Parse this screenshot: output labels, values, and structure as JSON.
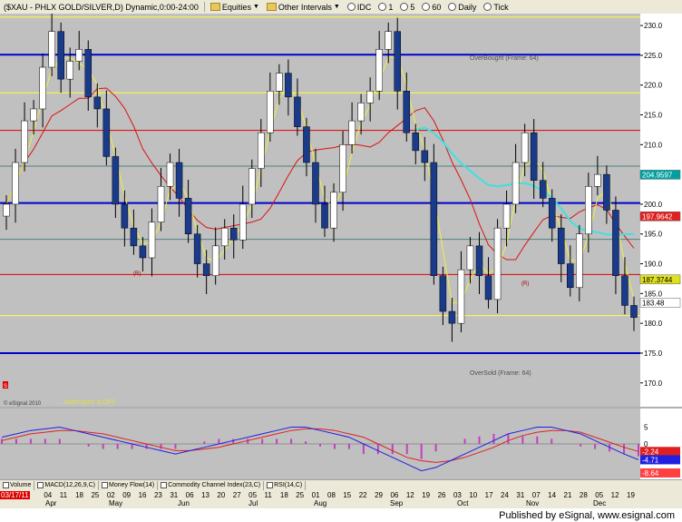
{
  "toolbar": {
    "symbol_title": "($XAU - PHLX GOLD/SILVER,D) Dynamic,0:00-24:00",
    "equities": "Equities",
    "other_intervals": "Other Intervals",
    "intervals": [
      "IDC",
      "1",
      "5",
      "60",
      "Daily",
      "Tick"
    ]
  },
  "annotations": {
    "overbought": "OverBought (Frame: 64)",
    "oversold": "OverSold (Frame: 64)",
    "autoframe": "AutoFrame is OFF",
    "copyright": "© eSignal 2010",
    "r_label": "(R)",
    "s_label": "S"
  },
  "price_tags": [
    {
      "text": "204.9597",
      "color": "#00a0a0"
    },
    {
      "text": "197.9642",
      "color": "#e02020"
    },
    {
      "text": "187.3744",
      "color": "#e0e020"
    },
    {
      "text": "183.48",
      "color": "#ffffff"
    }
  ],
  "macd_tags": [
    {
      "text": "-2.24",
      "color": "#e02020"
    },
    {
      "text": "-4.71",
      "color": "#2020e0"
    },
    {
      "text": "-8.64",
      "color": "#ff4040"
    }
  ],
  "date_start": "03/17/11",
  "x_day_labels": [
    "28",
    "04",
    "11",
    "18",
    "25",
    "02",
    "09",
    "16",
    "23",
    "31",
    "06",
    "13",
    "20",
    "27",
    "05",
    "11",
    "18",
    "25",
    "01",
    "08",
    "15",
    "22",
    "29",
    "06",
    "12",
    "19",
    "26",
    "03",
    "10",
    "17",
    "24",
    "31",
    "07",
    "14",
    "21",
    "28",
    "05",
    "12",
    "19"
  ],
  "x_month_labels": [
    "Apr",
    "May",
    "Jun",
    "Jul",
    "Aug",
    "Sep",
    "Oct",
    "Nov",
    "Dec"
  ],
  "indicator_tabs": [
    "Volume",
    "MACD(12,26,9,C)",
    "Money Flow(14)",
    "Commodity Channel Index(23,C)",
    "RSI(14,C)"
  ],
  "footer": "Published by eSignal, www.esignal.com",
  "colors": {
    "chart_bg": "#c0c0c0",
    "candle_up": "#ffffff",
    "candle_down": "#1a3a8a",
    "ma_red": "#e01010",
    "ma_yellow": "#f0f040",
    "ma_cyan": "#40e0e0",
    "level_blue": "#0000cc",
    "level_red": "#e00000",
    "level_yellow": "#ffff40",
    "level_teal": "#508080"
  },
  "chart_data": [
    {
      "type": "candlestick",
      "title": "($XAU - PHLX GOLD/SILVER,D) Dynamic,0:00-24:00",
      "ylim": [
        166,
        232
      ],
      "yticks": [
        170,
        175,
        180,
        185,
        190,
        195,
        200,
        205,
        210,
        215,
        220,
        225,
        230
      ],
      "close": [
        200,
        207,
        214,
        216,
        223,
        229,
        221,
        224,
        226,
        218,
        216,
        208,
        200,
        196,
        193,
        191,
        197,
        203,
        207,
        201,
        195,
        190,
        188,
        193,
        196,
        194,
        200,
        206,
        212,
        219,
        222,
        218,
        213,
        207,
        200,
        196,
        202,
        210,
        214,
        217,
        219,
        226,
        229,
        219,
        212,
        209,
        207,
        188,
        182,
        180,
        189,
        193,
        188,
        184,
        196,
        200,
        207,
        212,
        204,
        201,
        196,
        190,
        186,
        195,
        203,
        205,
        199,
        188,
        183,
        181
      ],
      "horizontal_levels": [
        {
          "value": 175,
          "color": "#0000cc"
        },
        {
          "value": 181.3,
          "color": "#ffff40"
        },
        {
          "value": 188.2,
          "color": "#e00000"
        },
        {
          "value": 194.1,
          "color": "#508080"
        },
        {
          "value": 200.2,
          "color": "#0000cc"
        },
        {
          "value": 206.4,
          "color": "#508080"
        },
        {
          "value": 212.4,
          "color": "#e00000"
        },
        {
          "value": 218.7,
          "color": "#ffff40"
        },
        {
          "value": 225.1,
          "color": "#0000cc"
        },
        {
          "value": 231.4,
          "color": "#ffff40"
        }
      ]
    },
    {
      "type": "line",
      "title": "MACD(12,26,9,C)",
      "ylim": [
        -10,
        10
      ],
      "yticks": [
        -5,
        0,
        5
      ],
      "series": [
        {
          "name": "MACD",
          "values": [
            2,
            3,
            4,
            4.5,
            5,
            4,
            3,
            2,
            1,
            0,
            -1,
            -2,
            -3,
            -2,
            -1,
            0,
            1,
            2,
            3,
            4,
            5,
            5,
            4,
            3,
            2,
            0,
            -2,
            -4,
            -6,
            -8,
            -7,
            -5,
            -3,
            -1,
            1,
            3,
            4,
            5,
            5,
            4,
            3,
            1,
            -1,
            -3,
            -4.71
          ]
        },
        {
          "name": "Signal",
          "values": [
            1,
            2,
            3,
            3.5,
            4,
            4,
            3.5,
            3,
            2,
            1,
            0,
            -1,
            -2,
            -2,
            -1.5,
            -1,
            0,
            1,
            2,
            3,
            4,
            4.5,
            4.5,
            4,
            3,
            2,
            0,
            -2,
            -4,
            -5,
            -5.5,
            -5,
            -4,
            -2.5,
            -1,
            1,
            2.5,
            3.5,
            4,
            4,
            3.5,
            2,
            0.5,
            -1,
            -2.24
          ]
        }
      ]
    }
  ]
}
